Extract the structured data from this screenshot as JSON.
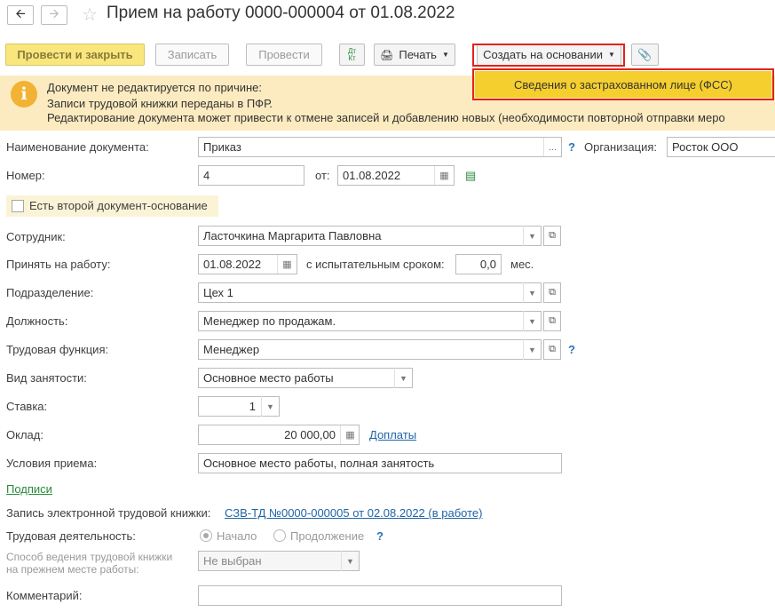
{
  "header": {
    "back_icon": "arrow-left-icon",
    "forward_icon": "arrow-right-icon",
    "favorite_icon": "star-icon",
    "title": "Прием на работу 0000-000004 от 01.08.2022"
  },
  "toolbar": {
    "post_and_close": "Провести и закрыть",
    "save": "Записать",
    "post": "Провести",
    "dt_kt": "Дт\nКт",
    "print": "Печать",
    "create_based_on": "Создать на основании",
    "attach_icon": "paperclip-icon"
  },
  "create_menu": {
    "items": [
      "Сведения о застрахованном лице (ФСС)"
    ]
  },
  "info": {
    "icon": "info-icon",
    "line1": "Документ не редактируется по причине:",
    "line2": "Записи трудовой книжки переданы в ПФР.",
    "line3": "Редактирование документа может привести к отмене записей и добавлению новых (необходимости повторной отправки меро"
  },
  "form": {
    "doc_name_label": "Наименование документа:",
    "doc_name_value": "Приказ",
    "doc_name_more": "...",
    "org_label": "Организация:",
    "org_value": "Росток ООО",
    "number_label": "Номер:",
    "number_value": "4",
    "from_label": "от:",
    "date_value": "01.08.2022",
    "second_doc_label": "Есть второй документ-основание",
    "employee_label": "Сотрудник:",
    "employee_value": "Ласточкина Маргарита Павловна",
    "hire_label": "Принять на работу:",
    "hire_date": "01.08.2022",
    "probation_label": "с испытательным сроком:",
    "probation_value": "0,0",
    "probation_unit": "мес.",
    "division_label": "Подразделение:",
    "division_value": "Цех 1",
    "position_label": "Должность:",
    "position_value": "Менеджер по продажам.",
    "function_label": "Трудовая функция:",
    "function_value": "Менеджер",
    "employment_label": "Вид занятости:",
    "employment_value": "Основное место работы",
    "rate_label": "Ставка:",
    "rate_value": "1",
    "salary_label": "Оклад:",
    "salary_value": "20 000,00",
    "allowances_link": "Доплаты",
    "conditions_label": "Условия приема:",
    "conditions_value": "Основное место работы, полная занятость",
    "signatures_link": "Подписи",
    "etk_label": "Запись электронной трудовой книжки:",
    "etk_link": "СЗВ-ТД №0000-000005 от 02.08.2022 (в работе)",
    "labor_label": "Трудовая деятельность:",
    "labor_opt1": "Начало",
    "labor_opt2": "Продолжение",
    "method_label1": "Способ ведения трудовой книжки",
    "method_label2": "на прежнем месте работы:",
    "method_value": "Не выбран",
    "comment_label": "Комментарий:",
    "comment_value": "",
    "help": "?"
  }
}
